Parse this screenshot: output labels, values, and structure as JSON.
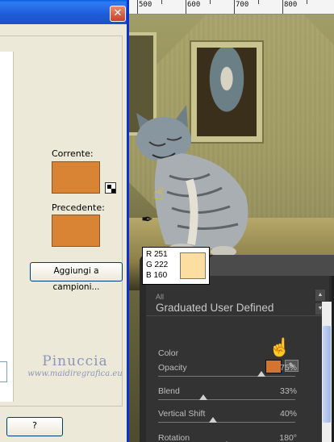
{
  "dialog": {
    "close_glyph": "✕",
    "current_label": "Corrente:",
    "previous_label": "Precedente:",
    "current_color": "#d98334",
    "previous_color": "#d98334",
    "add_to_swatches_label": "Aggiungi a campioni...",
    "help_label": "?"
  },
  "ruler": {
    "ticks": [
      "500",
      "600",
      "700",
      "800"
    ]
  },
  "tooltip": {
    "r": "R 251",
    "g": "G 222",
    "b": "B 160",
    "preview_color": "#fbdea0"
  },
  "panel": {
    "category": "All",
    "preset_name": "Graduated User Defined",
    "color_label": "Color",
    "color_value": "#d3742f",
    "sliders": [
      {
        "label": "Opacity",
        "value_text": "75%",
        "value": 75
      },
      {
        "label": "Blend",
        "value_text": "33%",
        "value": 33
      },
      {
        "label": "Vertical Shift",
        "value_text": "40%",
        "value": 40
      },
      {
        "label": "Rotation",
        "value_text": "180°",
        "value": 180
      }
    ]
  },
  "watermark": {
    "name": "Pinuccia",
    "url": "www.maidiregrafica.eu"
  },
  "icons": {
    "hand_pointer": "hand-pointer-icon",
    "eyedropper": "eyedropper-icon",
    "swap": "swap-colors-icon"
  }
}
